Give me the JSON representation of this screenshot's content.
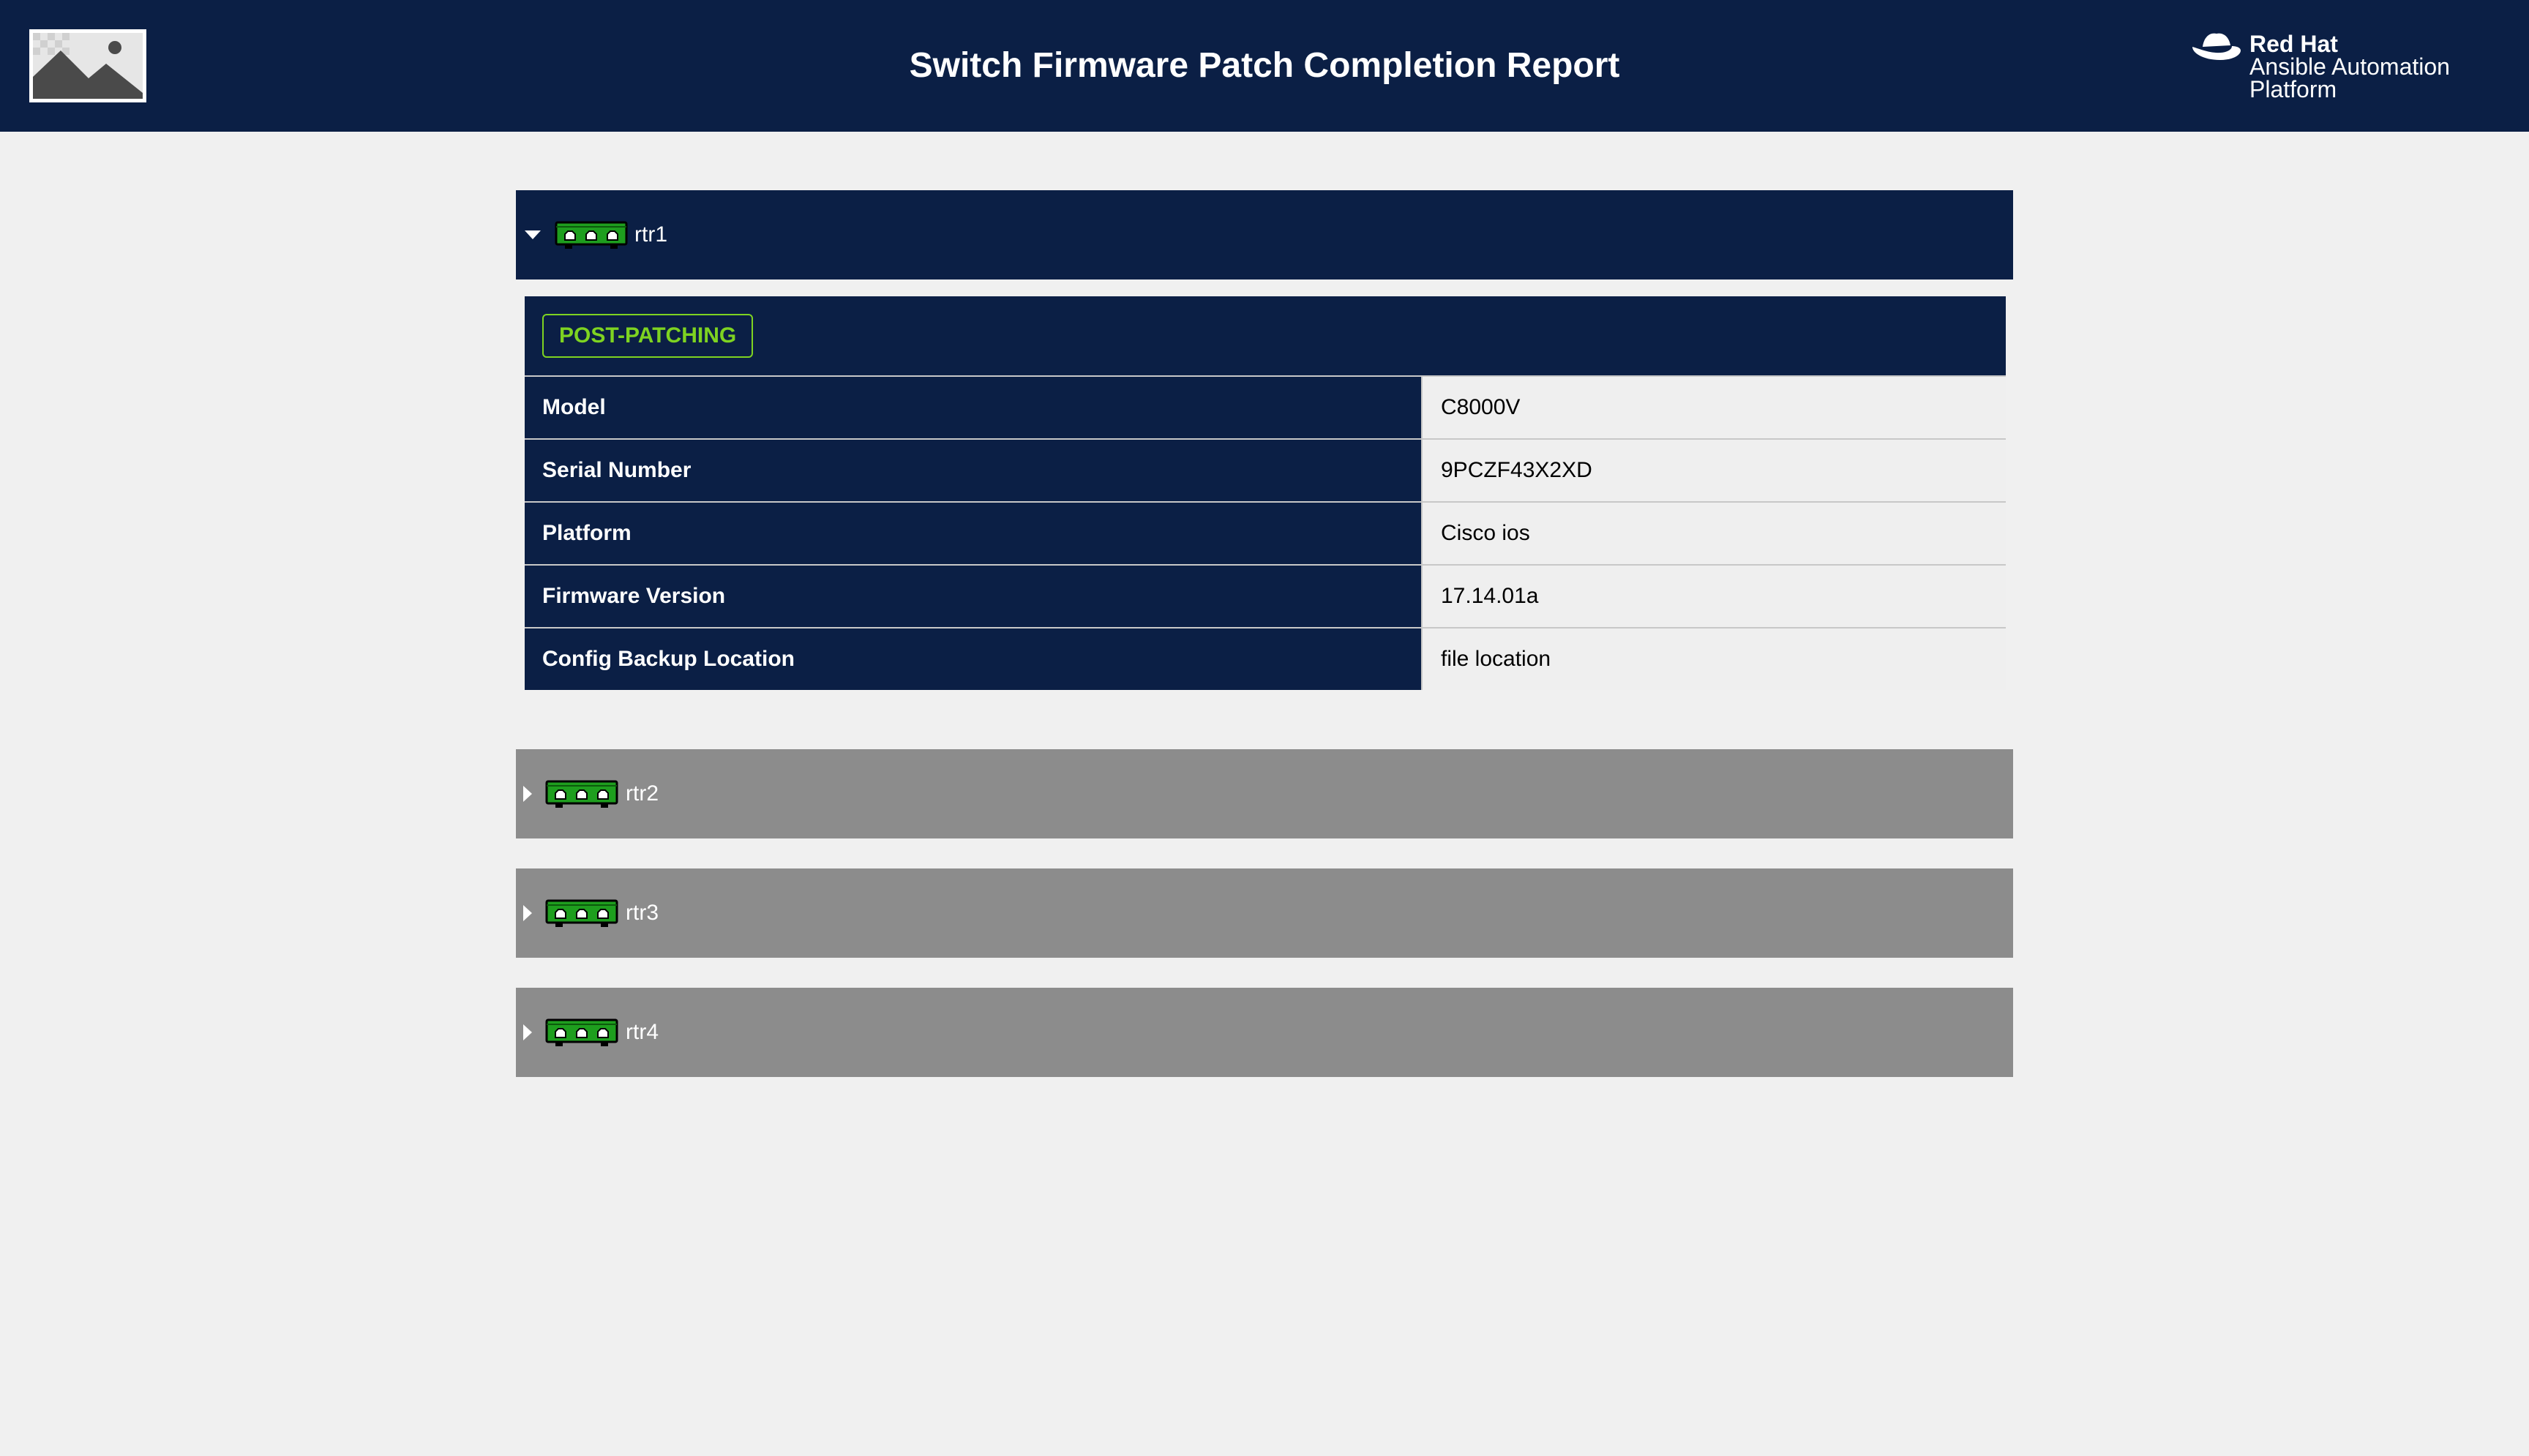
{
  "header": {
    "title": "Switch Firmware Patch Completion Report",
    "left_logo_icon": "image-placeholder-icon",
    "brand": {
      "icon": "red-hat-fedora-icon",
      "line1": "Red Hat",
      "line2": "Ansible Automation",
      "line3": "Platform"
    }
  },
  "hosts": [
    {
      "name": "rtr1",
      "expanded": true,
      "icon": "network-switch-icon",
      "status_badge": "POST-PATCHING",
      "details": [
        {
          "key": "Model",
          "value": "C8000V"
        },
        {
          "key": "Serial Number",
          "value": "9PCZF43X2XD"
        },
        {
          "key": "Platform",
          "value": "Cisco ios"
        },
        {
          "key": "Firmware Version",
          "value": "17.14.01a"
        },
        {
          "key": "Config Backup Location",
          "value": "file location"
        }
      ]
    },
    {
      "name": "rtr2",
      "expanded": false,
      "icon": "network-switch-icon"
    },
    {
      "name": "rtr3",
      "expanded": false,
      "icon": "network-switch-icon"
    },
    {
      "name": "rtr4",
      "expanded": false,
      "icon": "network-switch-icon"
    }
  ],
  "colors": {
    "header_bg": "#0b1f45",
    "collapsed_bg": "#8c8c8c",
    "page_bg": "#f0f0f0",
    "status_green": "#7ed321",
    "switch_green": "#1e9e1e"
  }
}
